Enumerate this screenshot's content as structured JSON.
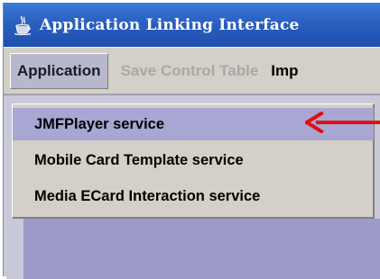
{
  "window": {
    "title": "Application Linking Interface",
    "icon": "java-cup-icon"
  },
  "menubar": {
    "items": [
      {
        "label": "Application",
        "state": "open"
      },
      {
        "label": "Save Control Table",
        "state": "disabled"
      },
      {
        "label": "Imp",
        "state": "normal"
      }
    ]
  },
  "dropdown": {
    "items": [
      {
        "label": "JMFPlayer service",
        "selected": true
      },
      {
        "label": "Mobile Card Template service",
        "selected": false
      },
      {
        "label": "Media ECard Interaction service",
        "selected": false
      }
    ]
  },
  "annotation": {
    "icon": "red-arrow-icon",
    "color": "#e01010"
  },
  "colors": {
    "titlebar": "#2a5fc0",
    "highlight": "#a8a6d2",
    "content": "#9c9ac8"
  }
}
